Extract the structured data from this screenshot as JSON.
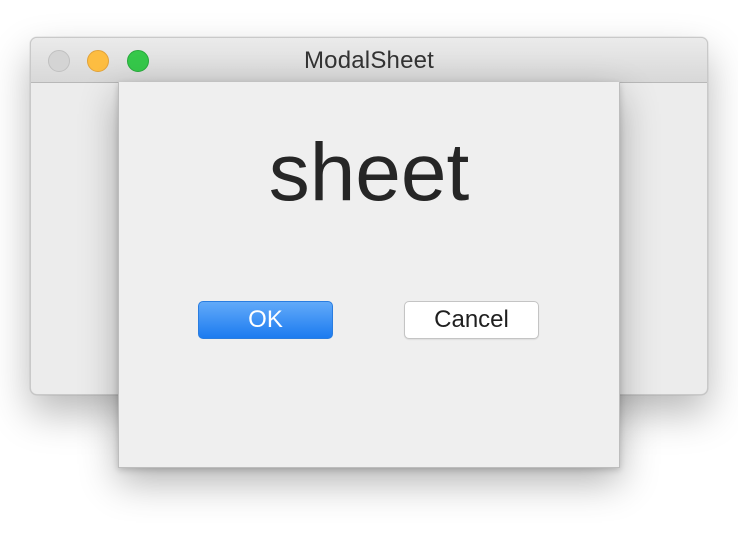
{
  "window": {
    "title": "ModalSheet",
    "traffic_lights": {
      "close_color": "#d4d4d4",
      "minimize_color": "#fdbd41",
      "zoom_color": "#35c84a"
    }
  },
  "sheet": {
    "label": "sheet",
    "ok_label": "OK",
    "cancel_label": "Cancel",
    "ok_color": "#1c7bf0"
  }
}
